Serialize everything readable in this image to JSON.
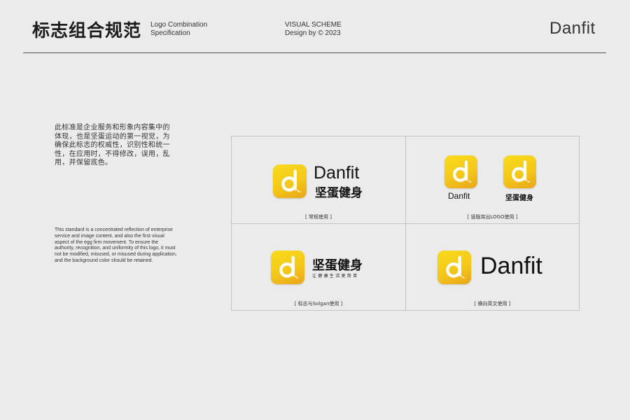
{
  "header": {
    "title_cn": "标志组合规范",
    "title_en_line1": "Logo Combination",
    "title_en_line2": "Specification",
    "scheme_line1": "VISUAL SCHEME",
    "scheme_line2": "Design by © 2023",
    "brand": "Danfit"
  },
  "description": {
    "cn": "此标准是企业服务和形象内容集中的体现，也是坚蛋运动的第一视觉，为确保此标志的权威性，识别性和统一性，在应用时，不得修改，误用，乱用，并保留底色。",
    "en": "This standard is a concentrated reflection of enterprise service and image content, and also the first visual aspect of the egg firm movement. To ensure the authority, recognition, and uniformity of this logo, it must not be modified, misused, or misused during application, and the background color should be retained."
  },
  "logos": {
    "wordmark_en": "Danfit",
    "wordmark_cn": "坚蛋健身",
    "slogan": "让健康生活更简单",
    "icon": "danfit-d-app-icon"
  },
  "captions": {
    "standard": "[ 常规使用 ]",
    "vertical": "[ 竖版突出LOGO使用 ]",
    "slogan": "[ 标志与Solgan使用 ]",
    "horizontal_en": "[ 横向英文使用 ]"
  },
  "colors": {
    "background": "#ebebeb",
    "icon_yellow": "#f5ce1b",
    "icon_orange": "#e9a51b",
    "text": "#111111"
  }
}
